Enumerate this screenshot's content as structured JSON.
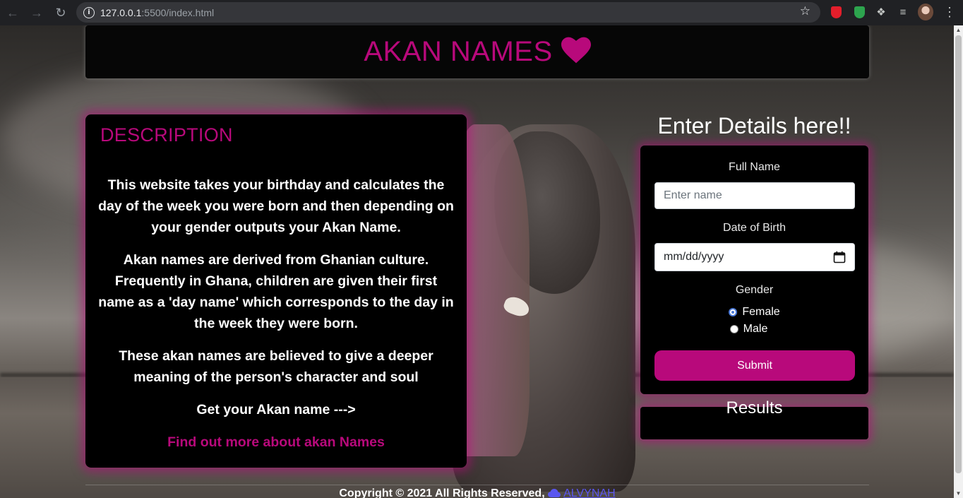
{
  "browser": {
    "url_host": "127.0.0.1",
    "url_rest": ":5500/index.html",
    "back_icon": "arrow-left-icon",
    "forward_icon": "arrow-right-icon",
    "reload_icon": "reload-icon",
    "bookmark_icon": "star-icon"
  },
  "header": {
    "title": "AKAN NAMES",
    "icon": "heart-icon",
    "accent_color": "#b8097b"
  },
  "description": {
    "title": "DESCRIPTION",
    "paragraphs": [
      "This website takes your birthday and calculates the day of the week you were born and then depending on your gender outputs your Akan Name.",
      "Akan names are derived from Ghanian culture. Frequently in Ghana, children are given their first name as a 'day name' which corresponds to the day in the week they were born.",
      "These akan names are believed to give a deeper meaning of the person's character and soul",
      "Get your Akan name --->"
    ],
    "link_text": "Find out more about akan Names"
  },
  "form": {
    "title": "Enter Details here!!",
    "name_label": "Full Name",
    "name_placeholder": "Enter name",
    "dob_label": "Date of Birth",
    "dob_placeholder": "mm/dd/yyyy",
    "gender_label": "Gender",
    "gender_options": [
      {
        "label": "Female",
        "checked": true
      },
      {
        "label": "Male",
        "checked": false
      }
    ],
    "submit_label": "Submit"
  },
  "results": {
    "title": "Results",
    "value": ""
  },
  "footer": {
    "copyright": "Copyright © 2021 All Rights Reserved,",
    "brand": "ALVYNAH"
  }
}
